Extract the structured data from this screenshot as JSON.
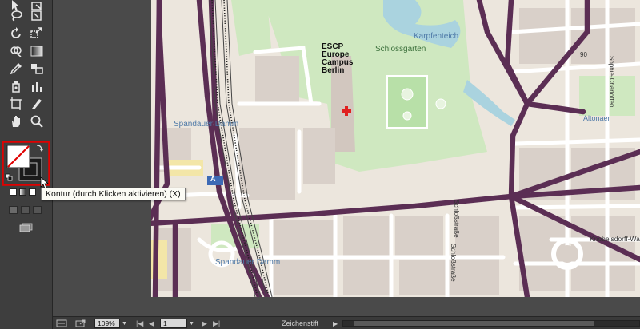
{
  "colors": {
    "panel_bg": "#3e3e3e",
    "highlight_box": "#e00000",
    "map_major_road": "#5b2e54",
    "map_minor_road": "#ffffff",
    "map_park": "#cfe8c0",
    "map_building": "#d9d0c9",
    "map_water": "#aad3df"
  },
  "tools": [
    {
      "name": "direct-selection-icon"
    },
    {
      "name": "group-selection-icon"
    },
    {
      "name": "lasso-icon"
    },
    {
      "name": "magic-wand-icon"
    },
    {
      "name": "rotate-icon"
    },
    {
      "name": "scale-icon"
    },
    {
      "name": "shape-builder-icon"
    },
    {
      "name": "gradient-icon"
    },
    {
      "name": "eyedropper-icon"
    },
    {
      "name": "blend-icon"
    },
    {
      "name": "symbol-sprayer-icon"
    },
    {
      "name": "column-graph-icon"
    },
    {
      "name": "artboard-icon"
    },
    {
      "name": "slice-icon"
    },
    {
      "name": "hand-icon"
    },
    {
      "name": "zoom-icon"
    }
  ],
  "tooltip": {
    "text": "Kontur (durch Klicken aktivieren) (X)"
  },
  "map": {
    "labels": {
      "escp_1": "ESCP",
      "escp_2": "Europe",
      "escp_3": "Campus",
      "escp_4": "Berlin",
      "karpfenteich": "Karpfenteich",
      "schlossgarten": "Schlossgarten",
      "spandauer_1": "Spandauer Damm",
      "spandauer_2": "Spandauer Damm",
      "altonaer": "Altonaer",
      "sophie": "Sophie-Charlotten",
      "schlossstrasse_1": "Schloßstraße",
      "schlossstrasse_2": "Schloßstraße",
      "knobelsdorff": "Knobelsdorff-Wa",
      "number_90": "90",
      "station_sign": "A"
    }
  },
  "status": {
    "zoom": "109%",
    "artboard_number": "1",
    "current_tool": "Zeichenstift"
  }
}
